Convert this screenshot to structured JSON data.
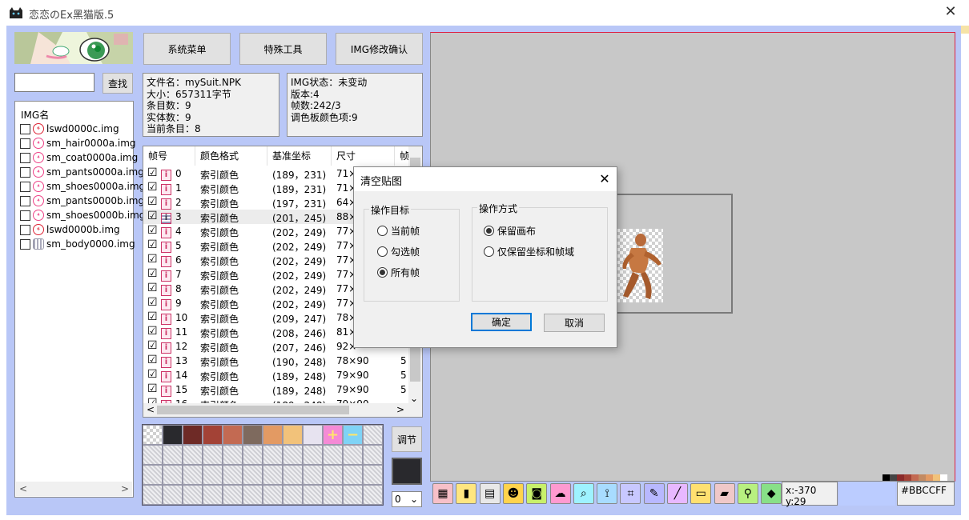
{
  "window": {
    "title": "恋恋のEx黑猫版.5",
    "close_glyph": "✕"
  },
  "sidebar": {
    "search_placeholder": "",
    "search_button": "查找",
    "list_header": "IMG名",
    "items": [
      {
        "name": "lswd0000c.img",
        "icon": "red-round-icon",
        "checked": false
      },
      {
        "name": "sm_hair0000a.img",
        "icon": "pink-round-icon",
        "checked": false
      },
      {
        "name": "sm_coat0000a.img",
        "icon": "pink-round-icon",
        "checked": false
      },
      {
        "name": "sm_pants0000a.img",
        "icon": "pink-round-icon",
        "checked": false
      },
      {
        "name": "sm_shoes0000a.img",
        "icon": "pink-round-icon",
        "checked": false
      },
      {
        "name": "sm_pants0000b.img",
        "icon": "pink-round-icon",
        "checked": false
      },
      {
        "name": "sm_shoes0000b.img",
        "icon": "pink-round-icon",
        "checked": false
      },
      {
        "name": "lswd0000b.img",
        "icon": "red-round-icon",
        "checked": false
      },
      {
        "name": "sm_body0000.img",
        "icon": "grid-icon",
        "checked": false
      }
    ],
    "scroll_left": "<",
    "scroll_right": ">"
  },
  "toolbar_top": {
    "system_menu": "系统菜单",
    "special_tools": "特殊工具",
    "img_confirm": "IMG修改确认"
  },
  "file_info": {
    "filename": "文件名：mySuit.NPK",
    "size": "大小：657311字节",
    "entries": "条目数：9",
    "entities": "实体数：9",
    "current": "当前条目：8"
  },
  "img_info": {
    "status": "IMG状态：未变动",
    "version": "版本:4",
    "frames": "帧数:242/3",
    "palette": "调色板颜色项:9"
  },
  "frame_table": {
    "columns": [
      "帧号",
      "颜色格式",
      "基准坐标",
      "尺寸",
      "帧"
    ],
    "rows": [
      {
        "no": "0",
        "format": "索引颜色",
        "coord": "(189，231)",
        "size": "71×",
        "extra": ""
      },
      {
        "no": "1",
        "format": "索引颜色",
        "coord": "(189，231)",
        "size": "71×",
        "extra": ""
      },
      {
        "no": "2",
        "format": "索引颜色",
        "coord": "(197，231)",
        "size": "64×",
        "extra": ""
      },
      {
        "no": "3",
        "format": "索引颜色",
        "coord": "(201，245)",
        "size": "88×",
        "extra": ""
      },
      {
        "no": "4",
        "format": "索引颜色",
        "coord": "(202，249)",
        "size": "77×",
        "extra": ""
      },
      {
        "no": "5",
        "format": "索引颜色",
        "coord": "(202，249)",
        "size": "77×",
        "extra": ""
      },
      {
        "no": "6",
        "format": "索引颜色",
        "coord": "(202，249)",
        "size": "77×",
        "extra": ""
      },
      {
        "no": "7",
        "format": "索引颜色",
        "coord": "(202，249)",
        "size": "77×",
        "extra": ""
      },
      {
        "no": "8",
        "format": "索引颜色",
        "coord": "(202，249)",
        "size": "77×",
        "extra": ""
      },
      {
        "no": "9",
        "format": "索引颜色",
        "coord": "(202，249)",
        "size": "77×",
        "extra": ""
      },
      {
        "no": "10",
        "format": "索引颜色",
        "coord": "(209，247)",
        "size": "78×",
        "extra": ""
      },
      {
        "no": "11",
        "format": "索引颜色",
        "coord": "(208，246)",
        "size": "81×",
        "extra": ""
      },
      {
        "no": "12",
        "format": "索引颜色",
        "coord": "(207，246)",
        "size": "92×",
        "extra": ""
      },
      {
        "no": "13",
        "format": "索引颜色",
        "coord": "(190，248)",
        "size": "78×90",
        "extra": "5"
      },
      {
        "no": "14",
        "format": "索引颜色",
        "coord": "(189，248)",
        "size": "79×90",
        "extra": "5"
      },
      {
        "no": "15",
        "format": "索引颜色",
        "coord": "(189，248)",
        "size": "79×90",
        "extra": "5"
      },
      {
        "no": "16",
        "format": "索引颜色",
        "coord": "(189，248)",
        "size": "79×90",
        "extra": ""
      }
    ],
    "selected_index": 3,
    "checkmark": "☑",
    "down_arrow": "⌄"
  },
  "palette": {
    "colors": [
      "#29292d",
      "#6e2a26",
      "#a34236",
      "#c36a52",
      "#7e6a5e",
      "#e39a63",
      "#f2c27a",
      "#e7e3f0"
    ],
    "plus_glyph": "+",
    "minus_glyph": "−",
    "adjust_button": "调节",
    "current_color": "#29292d",
    "index_select": "0",
    "select_arrow": "⌄"
  },
  "status": {
    "coord": "x:-370 y:29",
    "hex": "#BBCCFF",
    "hex_swatch": "#BBCCFF"
  },
  "bottom_tools": [
    {
      "name": "table-icon",
      "glyph": "▦",
      "bg": "#f7c0c8"
    },
    {
      "name": "bars-icon",
      "glyph": "▮",
      "bg": "#ffe680"
    },
    {
      "name": "film-icon",
      "glyph": "▤",
      "bg": "#e8e8e8"
    },
    {
      "name": "cat-icon",
      "glyph": "☻",
      "bg": "#ffd34d"
    },
    {
      "name": "camera-icon",
      "glyph": "◙",
      "bg": "#c8f06a"
    },
    {
      "name": "cloud-icon",
      "glyph": "☁",
      "bg": "#ff9ad0"
    },
    {
      "name": "magnifier-icon",
      "glyph": "⌕",
      "bg": "#9ef2ff"
    },
    {
      "name": "align-icon",
      "glyph": "⟟",
      "bg": "#a8dcff"
    },
    {
      "name": "crop-icon",
      "glyph": "⌗",
      "bg": "#c8c8ff"
    },
    {
      "name": "pencil-icon",
      "glyph": "✎",
      "bg": "#b8b8ff"
    },
    {
      "name": "line-icon",
      "glyph": "╱",
      "bg": "#e8b8ff"
    },
    {
      "name": "rect-icon",
      "glyph": "▭",
      "bg": "#ffe070"
    },
    {
      "name": "eraser-icon",
      "glyph": "▰",
      "bg": "#f0c8c8"
    },
    {
      "name": "eyedropper-icon",
      "glyph": "⚲",
      "bg": "#b8f080"
    },
    {
      "name": "tag-icon",
      "glyph": "◆",
      "bg": "#88e088"
    }
  ],
  "mini_palette": [
    "#000000",
    "#444444",
    "#8a2a2a",
    "#a34236",
    "#c36a52",
    "#c38a62",
    "#e39a63",
    "#f2c27a",
    "#ffffff"
  ],
  "dialog": {
    "title": "清空贴图",
    "close_glyph": "✕",
    "target_group": "操作目标",
    "target_options": [
      "当前帧",
      "勾选帧",
      "所有帧"
    ],
    "target_selected": 2,
    "mode_group": "操作方式",
    "mode_options": [
      "保留画布",
      "仅保留坐标和帧域"
    ],
    "mode_selected": 0,
    "ok": "确定",
    "cancel": "取消"
  }
}
